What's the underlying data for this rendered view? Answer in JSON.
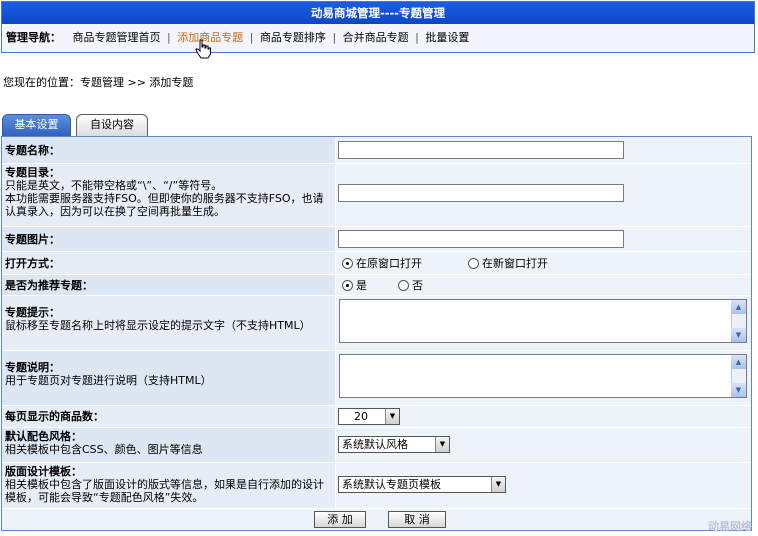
{
  "header": {
    "title": "动易商城管理----专题管理"
  },
  "nav": {
    "label": "管理导航：",
    "links": [
      "商品专题管理首页",
      "添加商品专题",
      "商品专题排序",
      "合并商品专题",
      "批量设置"
    ],
    "separator": "|"
  },
  "location": "您现在的位置：专题管理 >> 添加专题",
  "tabs": [
    "基本设置",
    "自设内容"
  ],
  "form": {
    "name_label": "专题名称：",
    "dir_label": "专题目录：",
    "dir_hint1": "只能是英文，不能带空格或“\\”、“/”等符号。",
    "dir_hint2": "本功能需要服务器支持FSO。但即使你的服务器不支持FSO，也请认真录入，因为可以在换了空间再批量生成。",
    "image_label": "专题图片：",
    "open_label": "打开方式：",
    "open_options": [
      "在原窗口打开",
      "在新窗口打开"
    ],
    "recommend_label": "是否为推荐专题：",
    "recommend_options": [
      "是",
      "否"
    ],
    "tip_label": "专题提示：",
    "tip_hint": "鼠标移至专题名称上时将显示设定的提示文字（不支持HTML）",
    "desc_label": "专题说明：",
    "desc_hint": "用于专题页对专题进行说明（支持HTML）",
    "perpage_label": "每页显示的商品数：",
    "perpage_value": "20",
    "style_label": "默认配色风格：",
    "style_hint": "相关模板中包含CSS、颜色、图片等信息",
    "style_value": "系统默认风格",
    "template_label": "版面设计模板：",
    "template_hint": "相关模板中包含了版面设计的版式等信息，如果是自行添加的设计模板，可能会导致“专题配色风格”失效。",
    "template_value": "系统默认专题页模板"
  },
  "buttons": {
    "add": "添 加",
    "cancel": "取 消"
  },
  "watermark": "动易网络"
}
